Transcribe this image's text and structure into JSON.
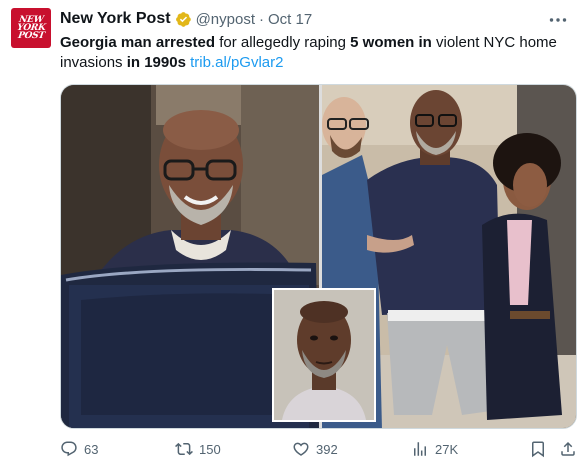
{
  "account": {
    "name": "New York Post",
    "handle": "@nypost",
    "separator": "·",
    "time": "Oct 17",
    "avatar_lines": [
      "NEW",
      "YORK",
      "POST"
    ],
    "avatar_color": "#c8102e",
    "verified_color": "#e2b719"
  },
  "more_icon": "more-horizontal-icon",
  "tweet": {
    "t1": "Georgia man arrested",
    "t2": " for allegedly raping ",
    "t3": "5 women in",
    "t4": " violent NYC home invasions ",
    "t5": "in 1990s",
    "t6": " ",
    "link": "trib.al/pGvlar2"
  },
  "actions": {
    "replies": "63",
    "reposts": "150",
    "likes": "392",
    "views": "27K"
  },
  "colors": {
    "link": "#1d9bf0",
    "muted": "#536471"
  }
}
